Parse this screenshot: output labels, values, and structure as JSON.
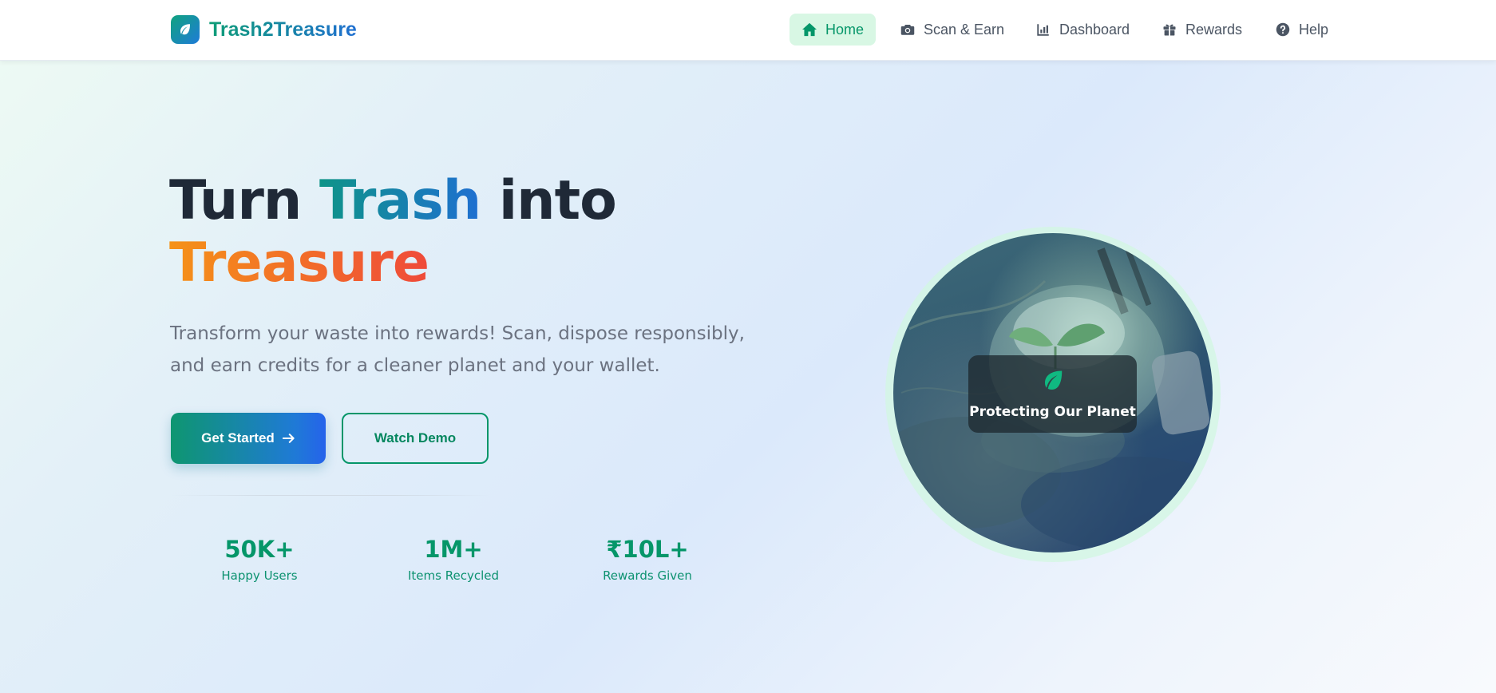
{
  "brand": {
    "name": "Trash2Treasure",
    "icon": "leaf-icon"
  },
  "nav": {
    "items": [
      {
        "label": "Home",
        "icon": "home-icon",
        "active": true
      },
      {
        "label": "Scan & Earn",
        "icon": "camera-icon",
        "active": false
      },
      {
        "label": "Dashboard",
        "icon": "chart-icon",
        "active": false
      },
      {
        "label": "Rewards",
        "icon": "gift-icon",
        "active": false
      },
      {
        "label": "Help",
        "icon": "question-circle-icon",
        "active": false
      }
    ]
  },
  "hero": {
    "title_part1": "Turn ",
    "title_highlight1": "Trash",
    "title_part2": " into",
    "title_highlight2": "Treasure",
    "subtitle_line1": "Transform your waste into rewards! Scan, dispose responsibly,",
    "subtitle_line2": "and earn credits for a cleaner planet and your wallet.",
    "primary_button": "Get Started",
    "secondary_button": "Watch Demo",
    "image_overlay_label": "Protecting Our Planet"
  },
  "stats": [
    {
      "value": "50K+",
      "label": "Happy Users"
    },
    {
      "value": "1M+",
      "label": "Items Recycled"
    },
    {
      "value": "₹10L+",
      "label": "Rewards Given"
    }
  ],
  "colors": {
    "accent_green": "#059669",
    "accent_blue": "#1f6fd1",
    "accent_orange": "#f59218",
    "accent_red": "#ef4a3a",
    "nav_active_bg": "#d8f7e4"
  }
}
